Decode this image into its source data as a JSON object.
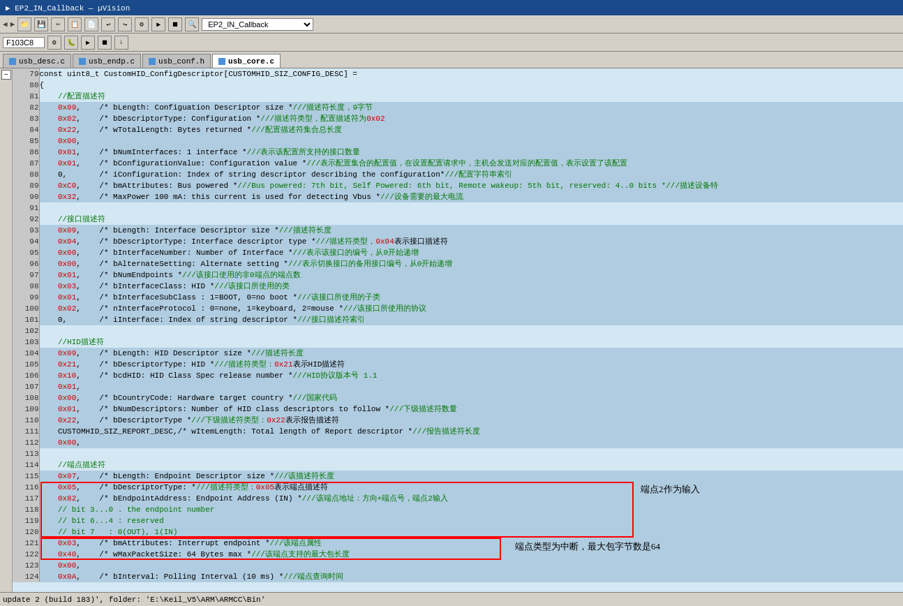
{
  "window": {
    "title": "EP2_IN_Callback"
  },
  "toolbar1": {
    "address": "F103C8",
    "dropdown": "EP2_IN_Callback"
  },
  "tabs": [
    {
      "label": "usb_desc.c",
      "active": false
    },
    {
      "label": "usb_endp.c",
      "active": false
    },
    {
      "label": "usb_conf.h",
      "active": false
    },
    {
      "label": "usb_core.c",
      "active": true
    }
  ],
  "status": {
    "text": "update 2 (build 183)', folder: 'E:\\Keil_V5\\ARM\\ARMCC\\Bin'"
  },
  "annotations": {
    "ann1": "端点2作为输入",
    "ann2": "端点类型为中断，最大包字节数是64"
  },
  "lines": [
    {
      "n": 79,
      "code": "const uint8_t CustomHID_ConfigDescriptor[CUSTOMHID_SIZ_CONFIG_DESC] ="
    },
    {
      "n": 80,
      "code": "{",
      "fold": true
    },
    {
      "n": 81,
      "code": "    //配置描述符",
      "cn": true
    },
    {
      "n": 82,
      "code": "    0x09,    /* bLength: Configuation Descriptor size *///描述符长度，9字节",
      "hl": true
    },
    {
      "n": 83,
      "code": "    0x02,    /* bDescriptorType: Configuration *///描述符类型，配置描述符为0x02",
      "hl": true
    },
    {
      "n": 84,
      "code": "    0x22,    /* wTotalLength: Bytes returned *///配置描述符集合总长度",
      "hl": true
    },
    {
      "n": 85,
      "code": "    0x00,",
      "hl": true
    },
    {
      "n": 86,
      "code": "    0x01,    /* bNumInterfaces: 1 interface *///表示该配置所支持的接口数量",
      "hl": true
    },
    {
      "n": 87,
      "code": "    0x01,    /* bConfigurationValue: Configuration value *///表示配置集合的配置值，在设置配置请求中，主机会发送对应的配置值，表示设置了该配置",
      "hl": true
    },
    {
      "n": 88,
      "code": "    0,       /* iConfiguration: Index of string descriptor describing the configuration*///配置字符串索引",
      "hl": true
    },
    {
      "n": 89,
      "code": "    0xC0,    /* bmAttributes: Bus powered *///Bus powered: 7th bit, Self Powered: 6th bit, Remote wakeup: 5th bit, reserved: 4..0 bits *///描述设备特",
      "hl": true
    },
    {
      "n": 90,
      "code": "    0x32,    /* MaxPower 100 mA: this current is used for detecting Vbus *///设备需要的最大电流",
      "hl": true
    },
    {
      "n": 91,
      "code": ""
    },
    {
      "n": 92,
      "code": "    //接口描述符",
      "cn": true
    },
    {
      "n": 93,
      "code": "    0x09,    /* bLength: Interface Descriptor size *///描述符长度",
      "hl": true
    },
    {
      "n": 94,
      "code": "    0x04,    /* bDescriptorType: Interface descriptor type *///描述符类型，0x04表示接口描述符",
      "hl": true
    },
    {
      "n": 95,
      "code": "    0x00,    /* bInterfaceNumber: Number of Interface *///表示该接口的编号，从0开始递增",
      "hl": true
    },
    {
      "n": 96,
      "code": "    0x00,    /* bAlternateSetting: Alternate setting *///表示切换接口的备用接口编号，从0开始递增",
      "hl": true
    },
    {
      "n": 97,
      "code": "    0x01,    /* bNumEndpoints *///该接口使用的非0端点的端点数",
      "hl": true
    },
    {
      "n": 98,
      "code": "    0x03,    /* bInterfaceClass: HID *///该接口所使用的类",
      "hl": true
    },
    {
      "n": 99,
      "code": "    0x01,    /* bInterfaceSubClass : 1=BOOT, 0=no boot *///该接口所使用的子类",
      "hl": true
    },
    {
      "n": 100,
      "code": "    0x02,    /* nInterfaceProtocol : 0=none, 1=keyboard, 2=mouse *///该接口所使用的协议",
      "hl": true
    },
    {
      "n": 101,
      "code": "    0,       /* iInterface: Index of string descriptor *///接口描述符索引",
      "hl": true
    },
    {
      "n": 102,
      "code": ""
    },
    {
      "n": 103,
      "code": "    //HID描述符",
      "cn": true
    },
    {
      "n": 104,
      "code": "    0x09,    /* bLength: HID Descriptor size *///描述符长度",
      "hl": true
    },
    {
      "n": 105,
      "code": "    0x21,    /* bDescriptorType: HID *///描述符类型：0x21表示HID描述符",
      "hl": true
    },
    {
      "n": 106,
      "code": "    0x10,    /* bcdHID: HID Class Spec release number *///HID协议版本号 1.1",
      "hl": true
    },
    {
      "n": 107,
      "code": "    0x01,",
      "hl": true
    },
    {
      "n": 108,
      "code": "    0x00,    /* bCountryCode: Hardware target country *///国家代码",
      "hl": true
    },
    {
      "n": 109,
      "code": "    0x01,    /* bNumDescriptors: Number of HID class descriptors to follow *///下级描述符数量",
      "hl": true
    },
    {
      "n": 110,
      "code": "    0x22,    /* bDescriptorType *///下级描述符类型：0x22表示报告描述符",
      "hl": true
    },
    {
      "n": 111,
      "code": "    CUSTOMHID_SIZ_REPORT_DESC,/* wItemLength: Total length of Report descriptor *///报告描述符长度",
      "hl": true
    },
    {
      "n": 112,
      "code": "    0x00,",
      "hl": true
    },
    {
      "n": 113,
      "code": ""
    },
    {
      "n": 114,
      "code": "    //端点描述符",
      "cn": true
    },
    {
      "n": 115,
      "code": "    0x07,    /* bLength: Endpoint Descriptor size *///该描述符长度",
      "hl": true
    },
    {
      "n": 116,
      "code": "    0x05,    /* bDescriptorType: *///描述符类型：0x05表示端点描述符",
      "hl": true,
      "redbox_start": true
    },
    {
      "n": 117,
      "code": "    0x82,    /* bEndpointAddress: Endpoint Address (IN) *///该端点地址：方向+端点号，端点2输入",
      "hl": true,
      "redbox": true
    },
    {
      "n": 118,
      "code": "    // bit 3...0 . the endpoint number",
      "hl": true,
      "redbox": true
    },
    {
      "n": 119,
      "code": "    // bit 6...4 : reserved",
      "hl": true,
      "redbox": true
    },
    {
      "n": 120,
      "code": "    // bit 7   : 0(OUT), 1(IN)",
      "hl": true,
      "redbox_end": true
    },
    {
      "n": 121,
      "code": "    0x03,    /* bmAttributes: Interrupt endpoint *///该端点属性",
      "hl": true,
      "redbox2_start": true
    },
    {
      "n": 122,
      "code": "    0x40,    /* wMaxPacketSize: 64 Bytes max *///该端点支持的最大包长度",
      "hl": true,
      "redbox2_end": true
    },
    {
      "n": 123,
      "code": "    0x00,",
      "hl": true
    },
    {
      "n": 124,
      "code": "    0x0A,    /* bInterval: Polling Interval (10 ms) *///端点查询时间",
      "hl": true
    }
  ]
}
